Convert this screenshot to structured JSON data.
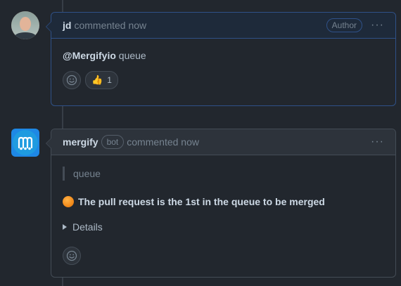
{
  "comments": [
    {
      "author": "jd",
      "action": "commented now",
      "badge": "Author",
      "menu_label": "···",
      "mention": "@Mergifyio",
      "body_text": "queue",
      "reactions": [
        {
          "emoji": "👍",
          "count": "1"
        }
      ]
    },
    {
      "author": "mergify",
      "bot_label": "bot",
      "action": "commented now",
      "menu_label": "···",
      "quote": "queue",
      "status_text": "The pull request is the 1st in the queue to be merged",
      "details_label": "Details"
    }
  ],
  "icons": {
    "smiley": "smiley-icon",
    "kebab": "kebab-icon",
    "status": "orange-circle-icon",
    "disclosure": "triangle-right-icon"
  },
  "colors": {
    "background": "#22272e",
    "author_border": "#2f5188",
    "status_orange": "#f28b1c",
    "mergify_blue": "#1f9be0"
  }
}
